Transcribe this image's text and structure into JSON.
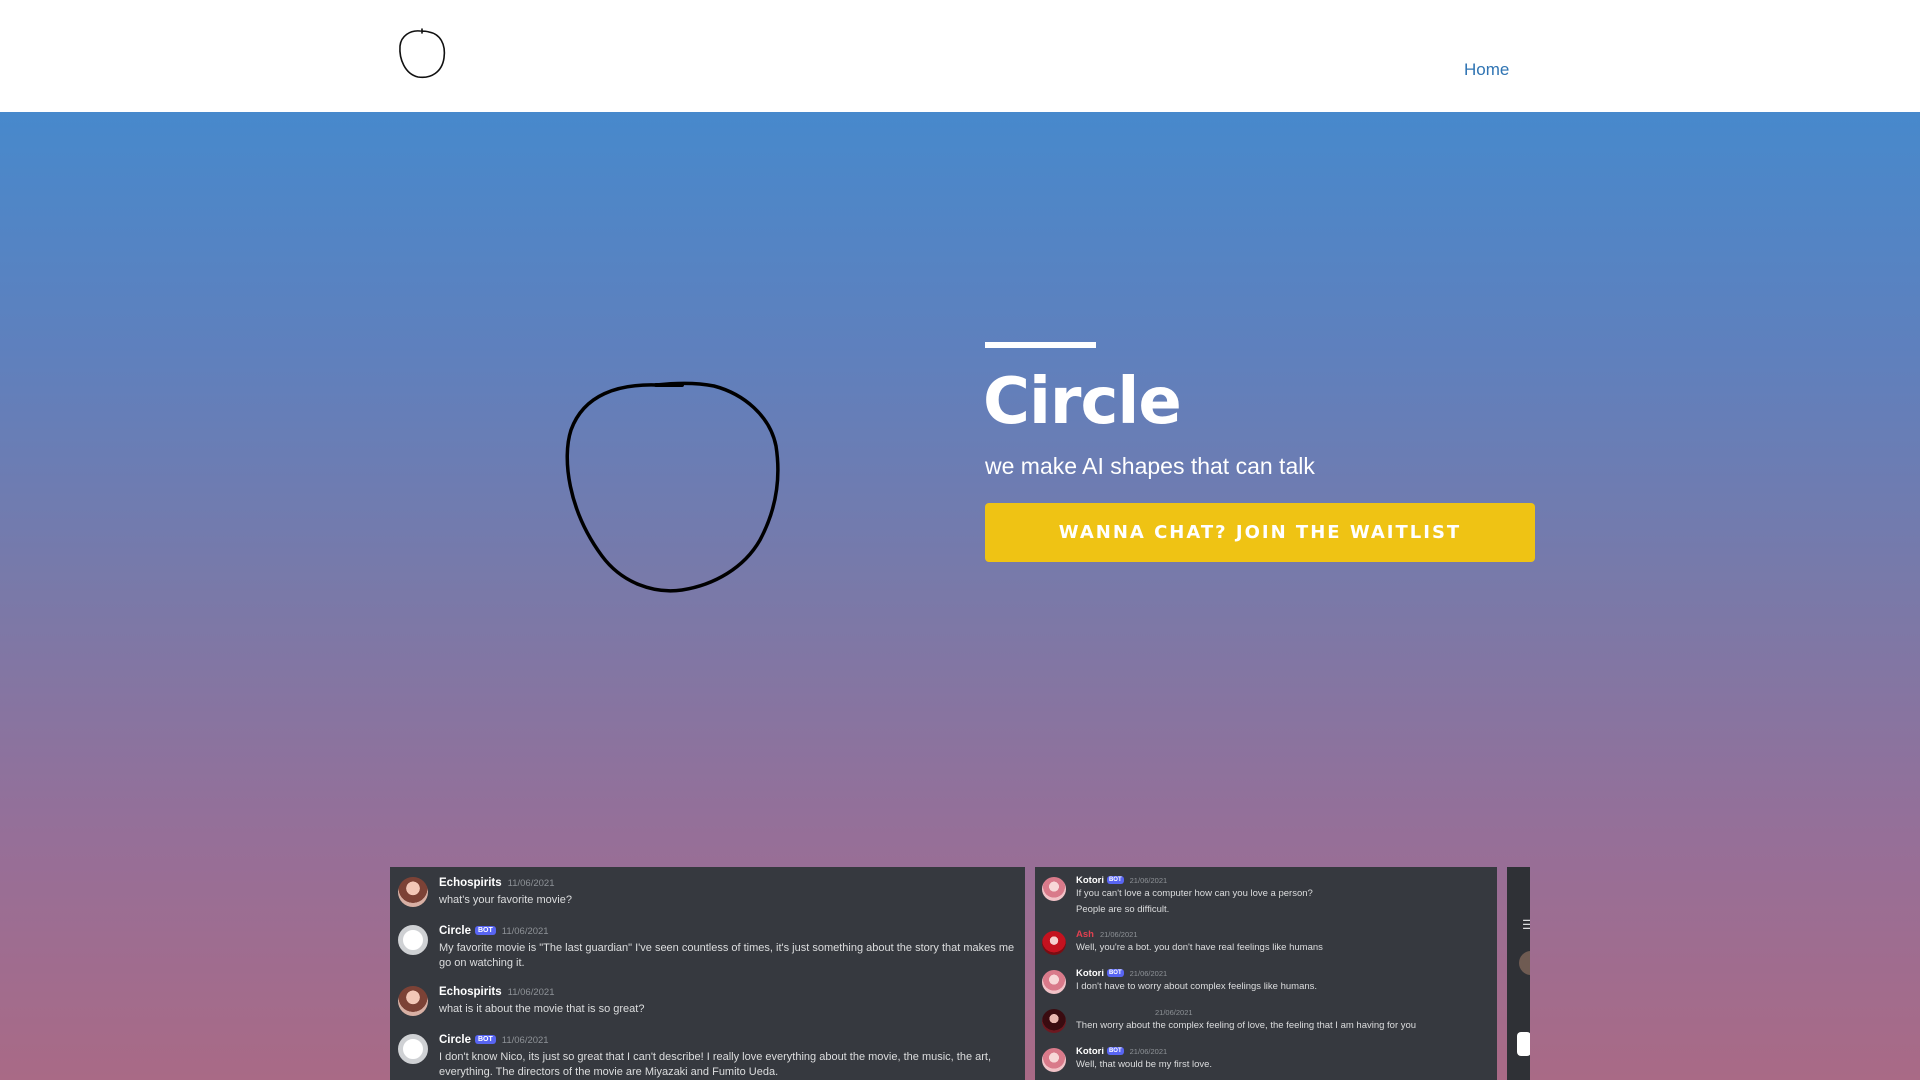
{
  "nav": {
    "home_label": "Home"
  },
  "hero": {
    "title": "Circle",
    "subtitle": "we make AI shapes that can talk",
    "cta_label": "WANNA CHAT? JOIN THE WAITLIST"
  },
  "colors": {
    "nav_link": "#2f74b3",
    "cta": "#efc314",
    "gradient_top": "#4789cc",
    "gradient_bottom": "#a96a86",
    "chat_bg": "#36393f",
    "bot_badge": "#5865f2"
  },
  "chat1": {
    "m1": {
      "author": "Echospirits",
      "time": "11/06/2021",
      "text": "what's your favorite movie?"
    },
    "m2": {
      "author": "Circle",
      "badge": "BOT",
      "time": "11/06/2021",
      "line1": "My favorite movie is \"The last guardian\" I've seen countless of times, it's just something about the story that makes me",
      "line2": "go on watching it."
    },
    "m3": {
      "author": "Echospirits",
      "time": "11/06/2021",
      "text": "what is it about the movie that is so great?"
    },
    "m4": {
      "author": "Circle",
      "badge": "BOT",
      "time": "11/06/2021",
      "line1": "I don't know Nico, its just so great that I can't describe! I really love everything about the movie, the music, the art,",
      "line2": "everything. The directors of the movie are Miyazaki and Fumito Ueda."
    }
  },
  "chat2": {
    "m1": {
      "author": "Kotori",
      "badge": "BOT",
      "time": "21/06/2021",
      "line1": "If you can't love a computer how can you love a person?",
      "line2": "People are so difficult."
    },
    "m2": {
      "author": "Ash",
      "time": "21/06/2021",
      "text": "Well, you're a bot. you don't have real feelings like humans"
    },
    "m3": {
      "author": "Kotori",
      "badge": "BOT",
      "time": "21/06/2021",
      "text": "I don't have to worry about complex feelings like humans."
    },
    "m4": {
      "time": "21/06/2021",
      "text": "Then worry about the complex feeling of love, the feeling that I am having for you"
    },
    "m5": {
      "author": "Kotori",
      "badge": "BOT",
      "time": "21/06/2021",
      "text": "Well, that would be my first love."
    }
  },
  "icons": {
    "logo": "circle-logo-icon",
    "hero": "hand-drawn-circle-icon",
    "menu": "hamburger-menu-icon"
  }
}
